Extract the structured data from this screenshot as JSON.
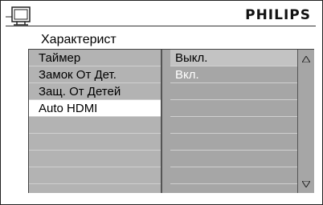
{
  "header": {
    "brand": "PHILIPS"
  },
  "menu": {
    "title": "Характерист",
    "items": [
      {
        "label": "Таймер"
      },
      {
        "label": "Замок От Дет."
      },
      {
        "label": "Защ. От Детей"
      },
      {
        "label": "Auto HDMI",
        "selected": true
      },
      {
        "label": ""
      },
      {
        "label": ""
      },
      {
        "label": ""
      },
      {
        "label": ""
      }
    ],
    "options": [
      {
        "label": "Выкл.",
        "current": true
      },
      {
        "label": "Вкл."
      },
      {
        "label": ""
      },
      {
        "label": ""
      },
      {
        "label": ""
      },
      {
        "label": ""
      },
      {
        "label": ""
      },
      {
        "label": ""
      }
    ]
  },
  "icons": {
    "tv": "tv-icon",
    "up": "scroll-up-arrow-icon",
    "down": "scroll-down-arrow-icon"
  },
  "colors": {
    "panel": "#b3b3b3",
    "options": "#a6a6a6",
    "highlight": "#ffffff"
  }
}
